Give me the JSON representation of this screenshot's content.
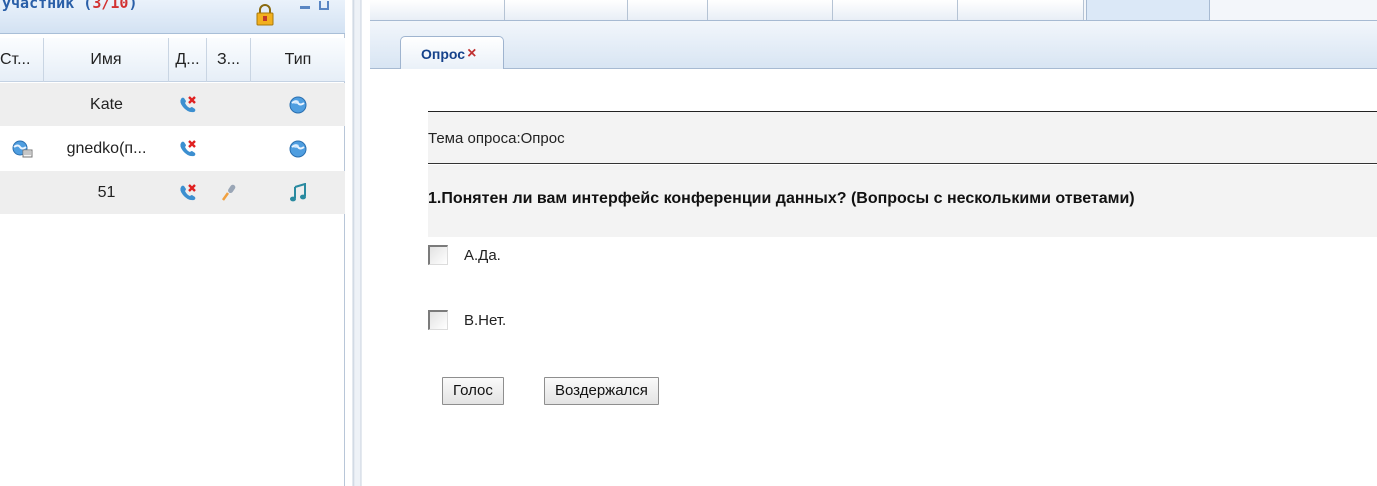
{
  "participants_panel": {
    "title": "участник",
    "count": "3/10",
    "columns": [
      "Ст...",
      "Имя",
      "Д...",
      "З...",
      "Тип"
    ],
    "rows": [
      {
        "name": "Kate",
        "status_icon": "",
        "data_icon": "phone-off-icon",
        "voice_icon": "",
        "type_icon": "globe-icon"
      },
      {
        "name": "gnedko(п...",
        "status_icon": "host-globe-icon",
        "data_icon": "phone-off-icon",
        "voice_icon": "",
        "type_icon": "globe-icon"
      },
      {
        "name": "51",
        "status_icon": "",
        "data_icon": "phone-off-icon",
        "voice_icon": "microphone-icon",
        "type_icon": "music-note-icon"
      }
    ]
  },
  "poll_tab": {
    "label": "Опрос",
    "close": "×"
  },
  "poll": {
    "topic": "Тема опроса:Опрос",
    "question": "1.Понятен ли вам интерфейс конференции данных? (Вопросы с несколькими ответами)",
    "answers": [
      "А.Да.",
      "В.Нет."
    ],
    "vote_button": "Голос",
    "abstain_button": "Воздержался"
  },
  "colors": {
    "header_blue": "#15428b",
    "count_red": "#d23232",
    "close_red": "#c03030"
  }
}
